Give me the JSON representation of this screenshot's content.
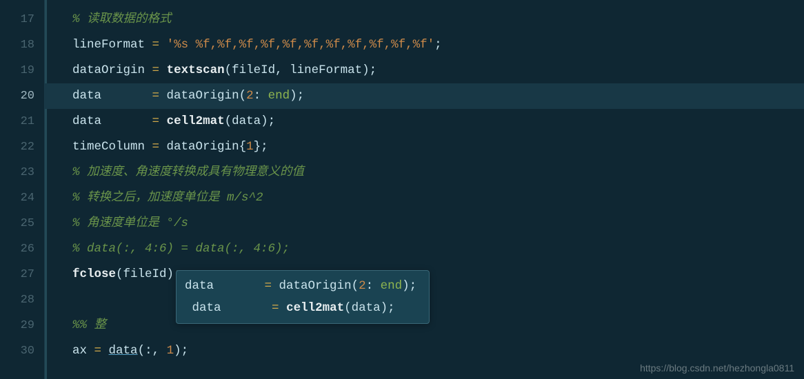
{
  "gutter": {
    "start": 17,
    "current": 20,
    "lines": [
      "17",
      "18",
      "19",
      "20",
      "21",
      "22",
      "23",
      "24",
      "25",
      "26",
      "27",
      "28",
      "29",
      "30"
    ]
  },
  "code": {
    "l17": "% 读取数据的格式",
    "l18": {
      "v1": "lineFormat ",
      "op": "=",
      "sp": " ",
      "str": "'%s %f,%f,%f,%f,%f,%f,%f,%f,%f,%f,%f'",
      "end": ";"
    },
    "l19": {
      "v1": "dataOrigin ",
      "op": "=",
      "sp": " ",
      "fn": "textscan",
      "args": "(fileId, lineFormat);"
    },
    "l20": {
      "v1": "data       ",
      "op": "=",
      "sp": " dataOrigin(",
      "num": "2",
      "colon": ": ",
      "end": "end",
      "close": ");"
    },
    "l21": {
      "v1": "data       ",
      "op": "=",
      "sp": " ",
      "fn": "cell2mat",
      "args": "(data);"
    },
    "l22": {
      "v1": "timeColumn ",
      "op": "=",
      "sp": " dataOrigin{",
      "num": "1",
      "close": "};"
    },
    "l23": "% 加速度、角速度转换成具有物理意义的值",
    "l24": "% 转换之后，加速度单位是 m/s^2",
    "l25": "% 角速度单位是 °/s",
    "l26": "% data(:, 4:6) = data(:, 4:6);",
    "l27": {
      "fn": "fclose",
      "args": "(fileId);"
    },
    "l29": "%% 整",
    "l30": {
      "v1": "ax ",
      "op": "=",
      "sp": " ",
      "fn": "data",
      "args1": "(:, ",
      "num": "1",
      "args2": ");"
    }
  },
  "tooltip": {
    "t1": {
      "v1": "data       ",
      "op": "=",
      "sp": " dataOrigin(",
      "num": "2",
      "colon": ": ",
      "end": "end",
      "close": ");"
    },
    "t2": {
      "pre": " data       ",
      "op": "=",
      "sp": " ",
      "fn": "cell2mat",
      "args": "(data);"
    }
  },
  "watermark": "https://blog.csdn.net/hezhongla0811"
}
